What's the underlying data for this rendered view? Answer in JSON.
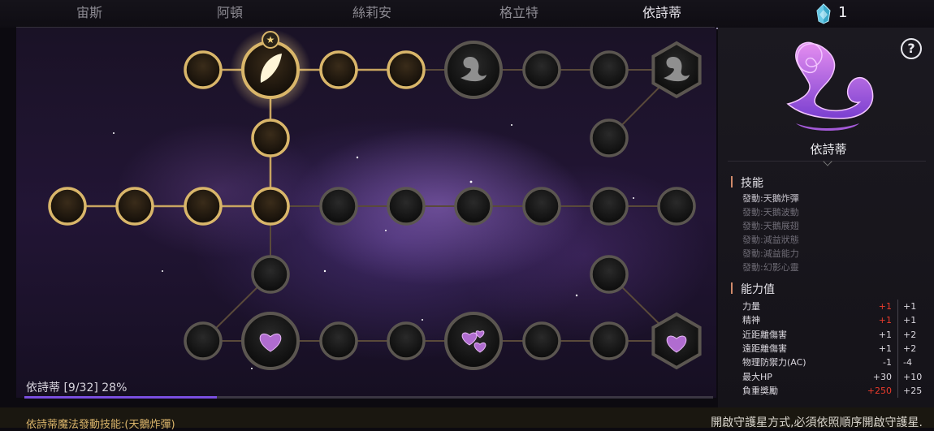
{
  "tabs": [
    {
      "label": "宙斯",
      "active": false
    },
    {
      "label": "阿頓",
      "active": false
    },
    {
      "label": "絲莉安",
      "active": false
    },
    {
      "label": "格立特",
      "active": false
    },
    {
      "label": "依詩蒂",
      "active": true
    }
  ],
  "crystal": {
    "icon": "crystal-icon",
    "count": "1"
  },
  "progress": {
    "label": "依詩蒂 [9/32] 28%",
    "percent": 28
  },
  "panel": {
    "name": "依詩蒂",
    "skills_title": "技能",
    "skills": [
      {
        "label": "發動:天鵝炸彈",
        "active": true
      },
      {
        "label": "發動:天鵝波動",
        "active": false
      },
      {
        "label": "發動:天鵝展翅",
        "active": false
      },
      {
        "label": "發動:減益狀態",
        "active": false
      },
      {
        "label": "發動:減益能力",
        "active": false
      },
      {
        "label": "發動:幻影心靈",
        "active": false
      }
    ],
    "stats_title": "能力值",
    "stats": [
      {
        "name": "力量",
        "current": "+1",
        "current_red": true,
        "total": "+1"
      },
      {
        "name": "精神",
        "current": "+1",
        "current_red": true,
        "total": "+1"
      },
      {
        "name": "近距離傷害",
        "current": "+1",
        "current_red": false,
        "total": "+2"
      },
      {
        "name": "遠距離傷害",
        "current": "+1",
        "current_red": false,
        "total": "+2"
      },
      {
        "name": "物理防禦力(AC)",
        "current": "-1",
        "current_red": false,
        "total": "-4"
      },
      {
        "name": "最大HP",
        "current": "+30",
        "current_red": false,
        "total": "+10"
      },
      {
        "name": "負重獎勵",
        "current": "+250",
        "current_red": true,
        "total": "+25"
      }
    ]
  },
  "bottom": {
    "left_text": "依詩蒂魔法發動技能:(天鵝炸彈)",
    "right_text": "開啟守護星方式,必須依照順序開啟守護星."
  },
  "board": {
    "nodes": [
      {
        "id": "a1",
        "kind": "moon",
        "lit": true
      },
      {
        "id": "a2",
        "kind": "feather",
        "lit": true,
        "selected": true
      },
      {
        "id": "a3",
        "kind": "moon",
        "lit": true
      },
      {
        "id": "a4",
        "kind": "moon",
        "lit": true
      },
      {
        "id": "a5",
        "kind": "swan",
        "lit": false
      },
      {
        "id": "a6",
        "kind": "moon",
        "lit": false
      },
      {
        "id": "a7",
        "kind": "moon",
        "lit": false
      },
      {
        "id": "a8",
        "kind": "swan-hex",
        "lit": false
      },
      {
        "id": "b1",
        "kind": "moon",
        "lit": true
      },
      {
        "id": "b2",
        "kind": "moon",
        "lit": false
      },
      {
        "id": "c1",
        "kind": "moon",
        "lit": true
      },
      {
        "id": "c2",
        "kind": "moon",
        "lit": true
      },
      {
        "id": "c3",
        "kind": "moon",
        "lit": true
      },
      {
        "id": "c4",
        "kind": "moon",
        "lit": true
      },
      {
        "id": "c5",
        "kind": "moon",
        "lit": false
      },
      {
        "id": "c6",
        "kind": "moon",
        "lit": false
      },
      {
        "id": "c7",
        "kind": "moon",
        "lit": false
      },
      {
        "id": "c8",
        "kind": "moon",
        "lit": false
      },
      {
        "id": "c9",
        "kind": "moon",
        "lit": false
      },
      {
        "id": "c10",
        "kind": "moon",
        "lit": false
      },
      {
        "id": "d1",
        "kind": "moon",
        "lit": false
      },
      {
        "id": "d2",
        "kind": "moon",
        "lit": false
      },
      {
        "id": "e1",
        "kind": "moon",
        "lit": false
      },
      {
        "id": "e2",
        "kind": "heart",
        "lit": false
      },
      {
        "id": "e3",
        "kind": "moon",
        "lit": false
      },
      {
        "id": "e4",
        "kind": "moon",
        "lit": false
      },
      {
        "id": "e5",
        "kind": "hearts",
        "lit": false
      },
      {
        "id": "e6",
        "kind": "moon",
        "lit": false
      },
      {
        "id": "e7",
        "kind": "moon",
        "lit": false
      },
      {
        "id": "e8",
        "kind": "swan-heart-hex",
        "lit": false
      }
    ]
  }
}
